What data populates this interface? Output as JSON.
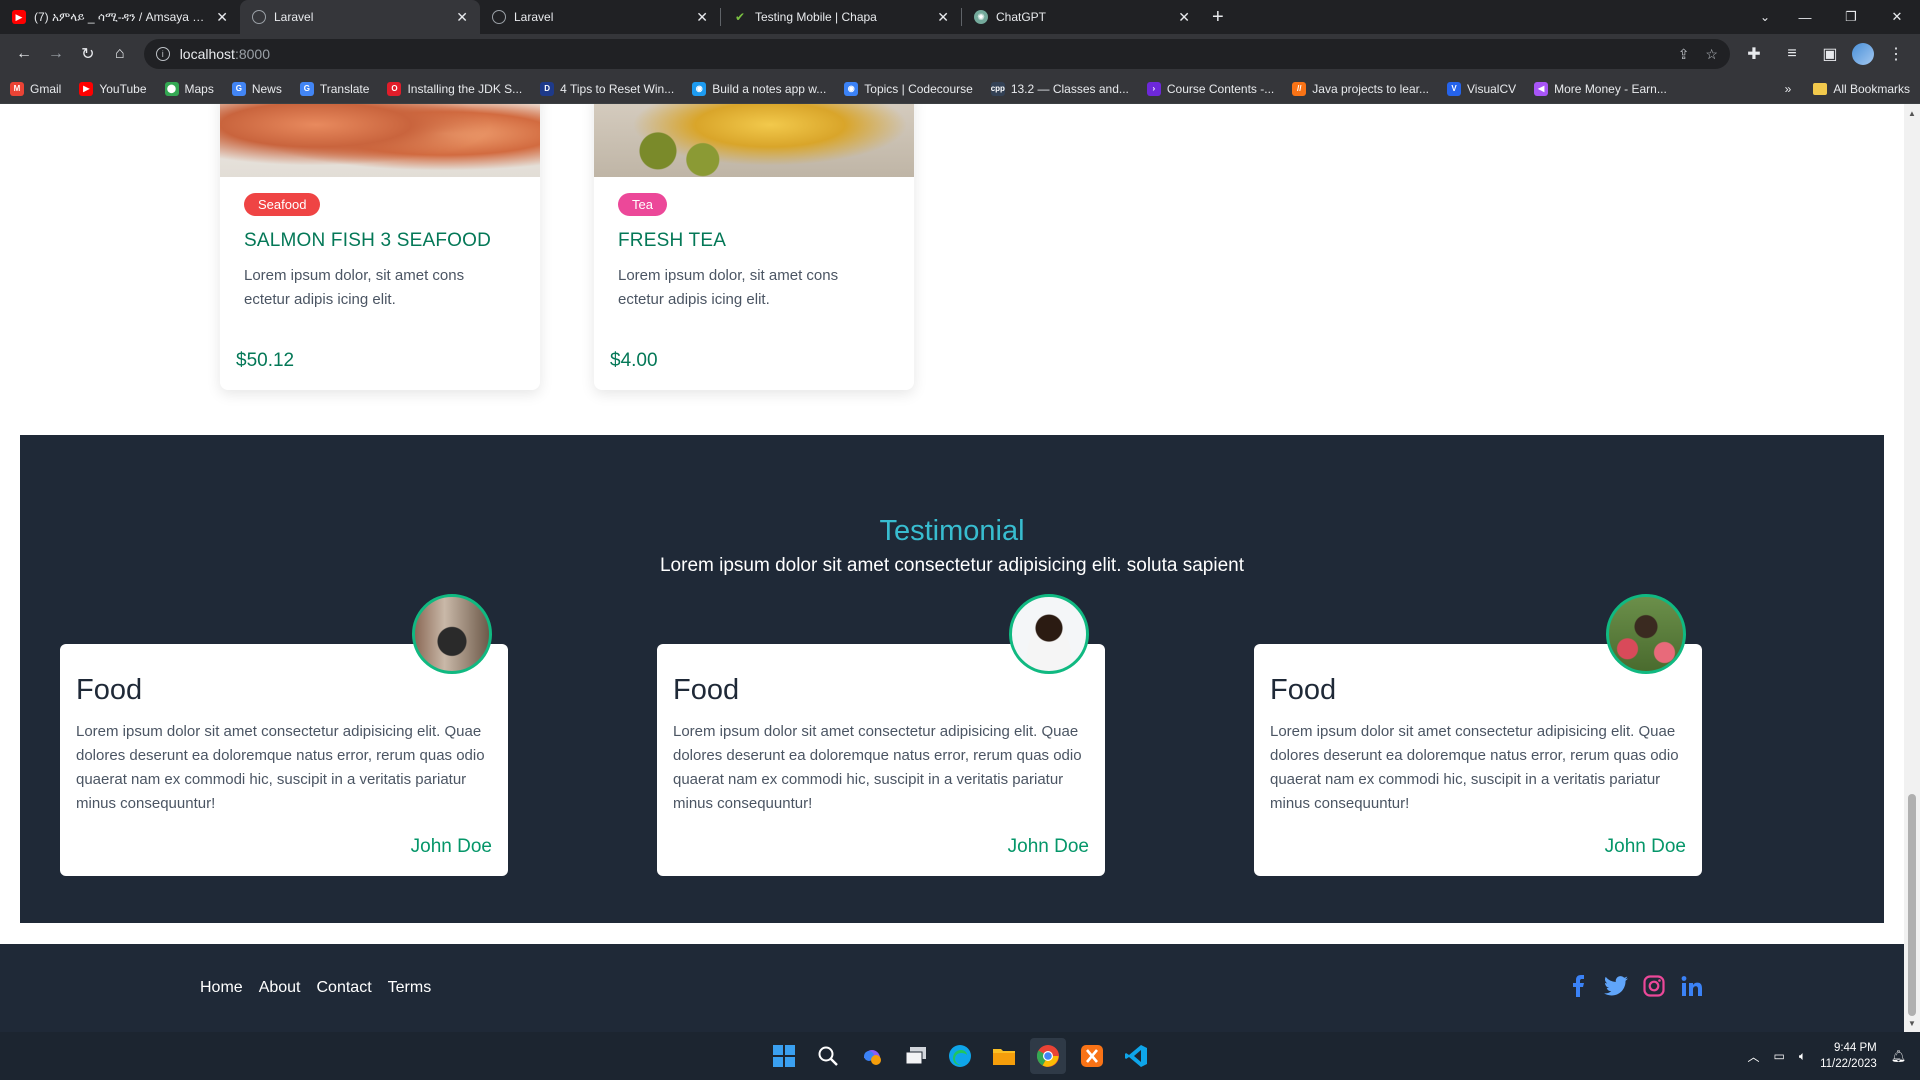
{
  "browser": {
    "tabs": [
      {
        "title": "(7) አምላይ _ ሳሚ-ዳን / Amsaya _ S",
        "favicon_color": "#ff0000",
        "active": false
      },
      {
        "title": "Laravel",
        "favicon_color": "#9aa0a6",
        "active": true
      },
      {
        "title": "Laravel",
        "favicon_color": "#9aa0a6",
        "active": false
      },
      {
        "title": "Testing Mobile | Chapa",
        "favicon_color": "#7ac142",
        "active": false
      },
      {
        "title": "ChatGPT",
        "favicon_color": "#74aa9c",
        "active": false
      }
    ],
    "new_tab_symbol": "+",
    "address": {
      "host": "localhost",
      "port": ":8000"
    },
    "bookmarks": [
      {
        "label": "Gmail",
        "color": "#ea4335",
        "glyph": "M"
      },
      {
        "label": "YouTube",
        "color": "#ff0000",
        "glyph": "▶"
      },
      {
        "label": "Maps",
        "color": "#34a853",
        "glyph": "⬤"
      },
      {
        "label": "News",
        "color": "#4285f4",
        "glyph": "G"
      },
      {
        "label": "Translate",
        "color": "#4285f4",
        "glyph": "G"
      },
      {
        "label": "Installing the JDK S...",
        "color": "#e11d2a",
        "glyph": "O"
      },
      {
        "label": "4 Tips to Reset Win...",
        "color": "#1e3a8a",
        "glyph": "D"
      },
      {
        "label": "Build a notes app w...",
        "color": "#1d9bf0",
        "glyph": "◉"
      },
      {
        "label": "Topics | Codecourse",
        "color": "#3b82f6",
        "glyph": "◉"
      },
      {
        "label": "13.2 — Classes and...",
        "color": "#334155",
        "glyph": "cpp"
      },
      {
        "label": "Course Contents -...",
        "color": "#6d28d9",
        "glyph": "›"
      },
      {
        "label": "Java projects to lear...",
        "color": "#f97316",
        "glyph": "//"
      },
      {
        "label": "VisualCV",
        "color": "#2563eb",
        "glyph": "V"
      },
      {
        "label": "More Money - Earn...",
        "color": "#a855f7",
        "glyph": "◀"
      }
    ],
    "bookmarks_overflow": "»",
    "all_bookmarks": "All Bookmarks"
  },
  "products": [
    {
      "badge": "Seafood",
      "title": "SALMON FISH 3 SEAFOOD",
      "description": "Lorem ipsum dolor, sit amet cons ectetur adipis icing elit.",
      "price": "$50.12"
    },
    {
      "badge": "Tea",
      "title": "FRESH TEA",
      "description": "Lorem ipsum dolor, sit amet cons ectetur adipis icing elit.",
      "price": "$4.00"
    }
  ],
  "testimonial": {
    "title": "Testimonial",
    "subtitle": "Lorem ipsum dolor sit amet consectetur adipisicing elit. soluta sapient",
    "cards": [
      {
        "title": "Food",
        "text": "Lorem ipsum dolor sit amet consectetur adipisicing elit. Quae dolores deserunt ea doloremque natus error, rerum quas odio quaerat nam ex commodi hic, suscipit in a veritatis pariatur minus consequuntur!",
        "author": "John Doe"
      },
      {
        "title": "Food",
        "text": "Lorem ipsum dolor sit amet consectetur adipisicing elit. Quae dolores deserunt ea doloremque natus error, rerum quas odio quaerat nam ex commodi hic, suscipit in a veritatis pariatur minus consequuntur!",
        "author": "John Doe"
      },
      {
        "title": "Food",
        "text": "Lorem ipsum dolor sit amet consectetur adipisicing elit. Quae dolores deserunt ea doloremque natus error, rerum quas odio quaerat nam ex commodi hic, suscipit in a veritatis pariatur minus consequuntur!",
        "author": "John Doe"
      }
    ]
  },
  "footer": {
    "nav": [
      "Home",
      "About",
      "Contact",
      "Terms"
    ],
    "socials": [
      "facebook-icon",
      "twitter-icon",
      "instagram-icon",
      "linkedin-icon"
    ]
  },
  "taskbar": {
    "time": "9:44 PM",
    "date": "11/22/2023"
  },
  "colors": {
    "accent_green": "#047857",
    "testimonial_title": "#38bdd0",
    "dark_bg": "#1f2937",
    "seafood_badge": "#ef4444",
    "tea_badge": "#ec4899"
  }
}
